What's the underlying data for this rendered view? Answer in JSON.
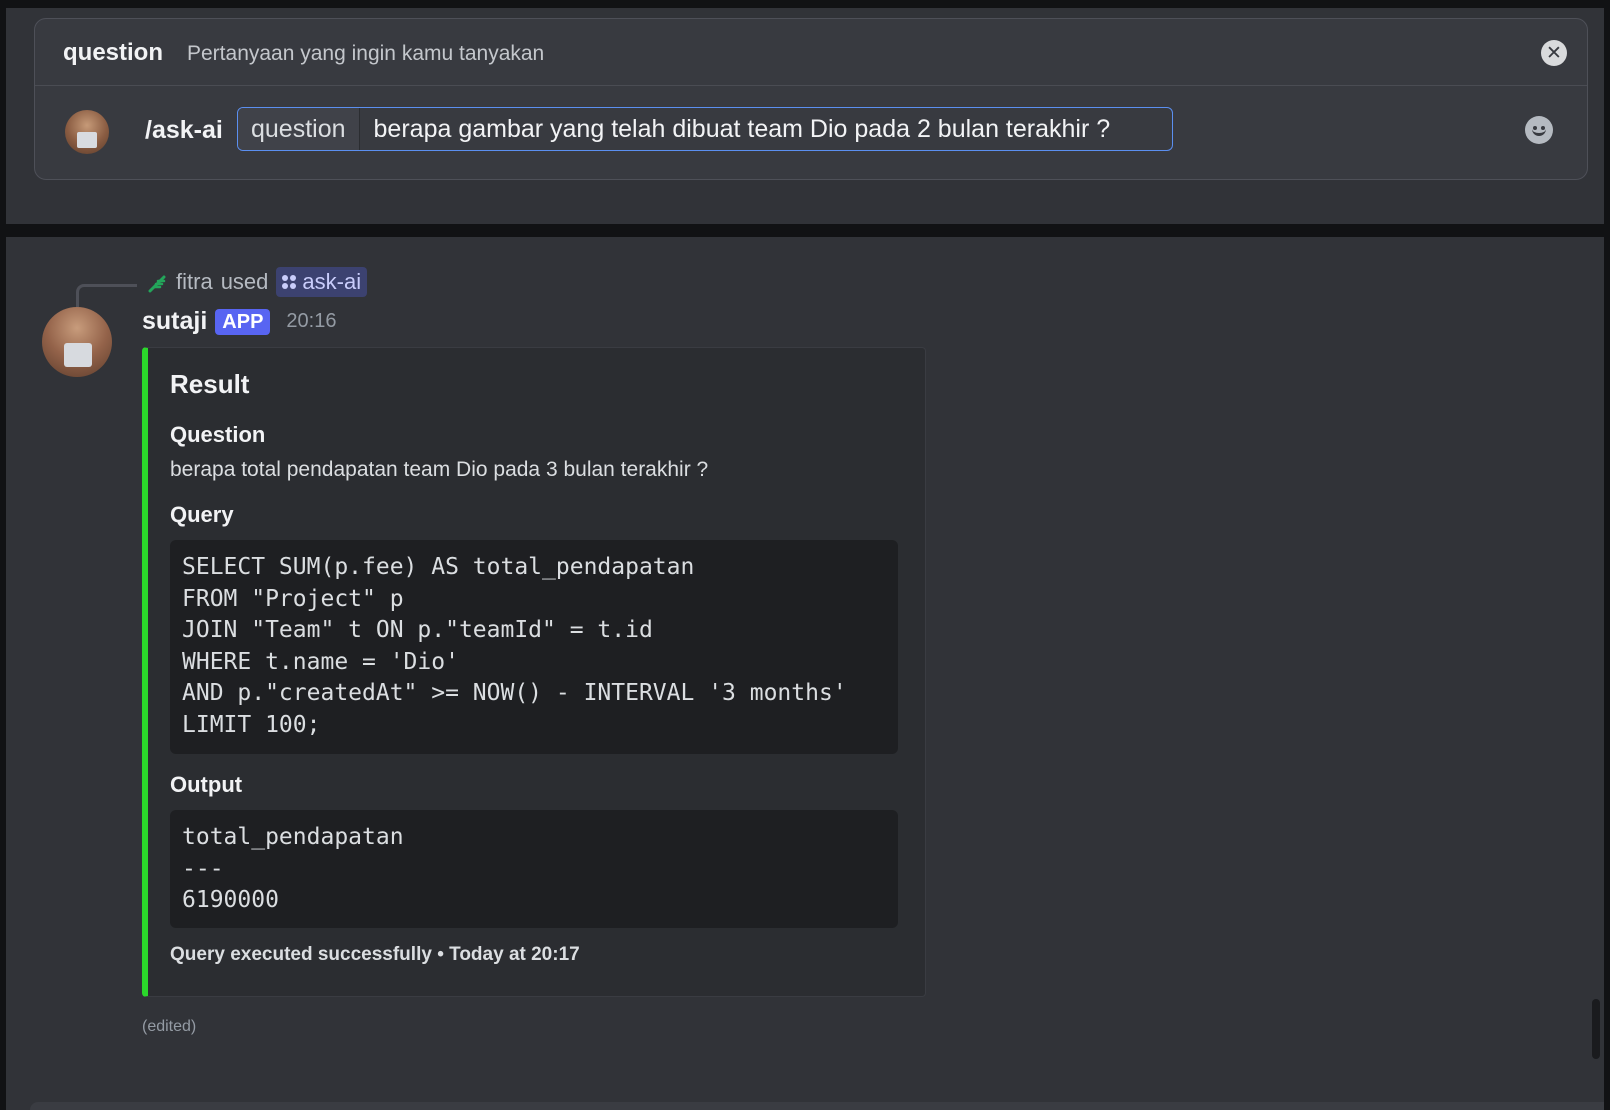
{
  "composer": {
    "option_name": "question",
    "option_description": "Pertanyaan yang ingin kamu tanyakan",
    "command": "/ask-ai",
    "option_label": "question",
    "option_value": "berapa gambar yang telah dibuat team Dio pada 2 bulan terakhir ?",
    "close_icon": "close-icon",
    "emoji_icon": "emoji-icon"
  },
  "message": {
    "reply": {
      "user": "fitra",
      "action": "used",
      "command": "ask-ai"
    },
    "author": "sutaji",
    "badge": "APP",
    "timestamp": "20:16",
    "embed": {
      "accent_color": "#2bd82b",
      "title": "Result",
      "fields": [
        {
          "name": "Question",
          "value": "berapa total pendapatan team Dio pada 3 bulan terakhir ?"
        },
        {
          "name": "Query",
          "code": [
            "SELECT SUM(p.fee) AS total_pendapatan",
            "FROM \"Project\" p",
            "JOIN \"Team\" t ON p.\"teamId\" = t.id",
            "WHERE t.name = 'Dio'",
            "AND p.\"createdAt\" >= NOW() - INTERVAL '3 months'",
            "LIMIT 100;"
          ]
        },
        {
          "name": "Output",
          "code": [
            "total_pendapatan",
            "---",
            "6190000"
          ]
        }
      ],
      "footer": "Query executed successfully • Today at 20:17"
    },
    "edited_label": "(edited)"
  }
}
